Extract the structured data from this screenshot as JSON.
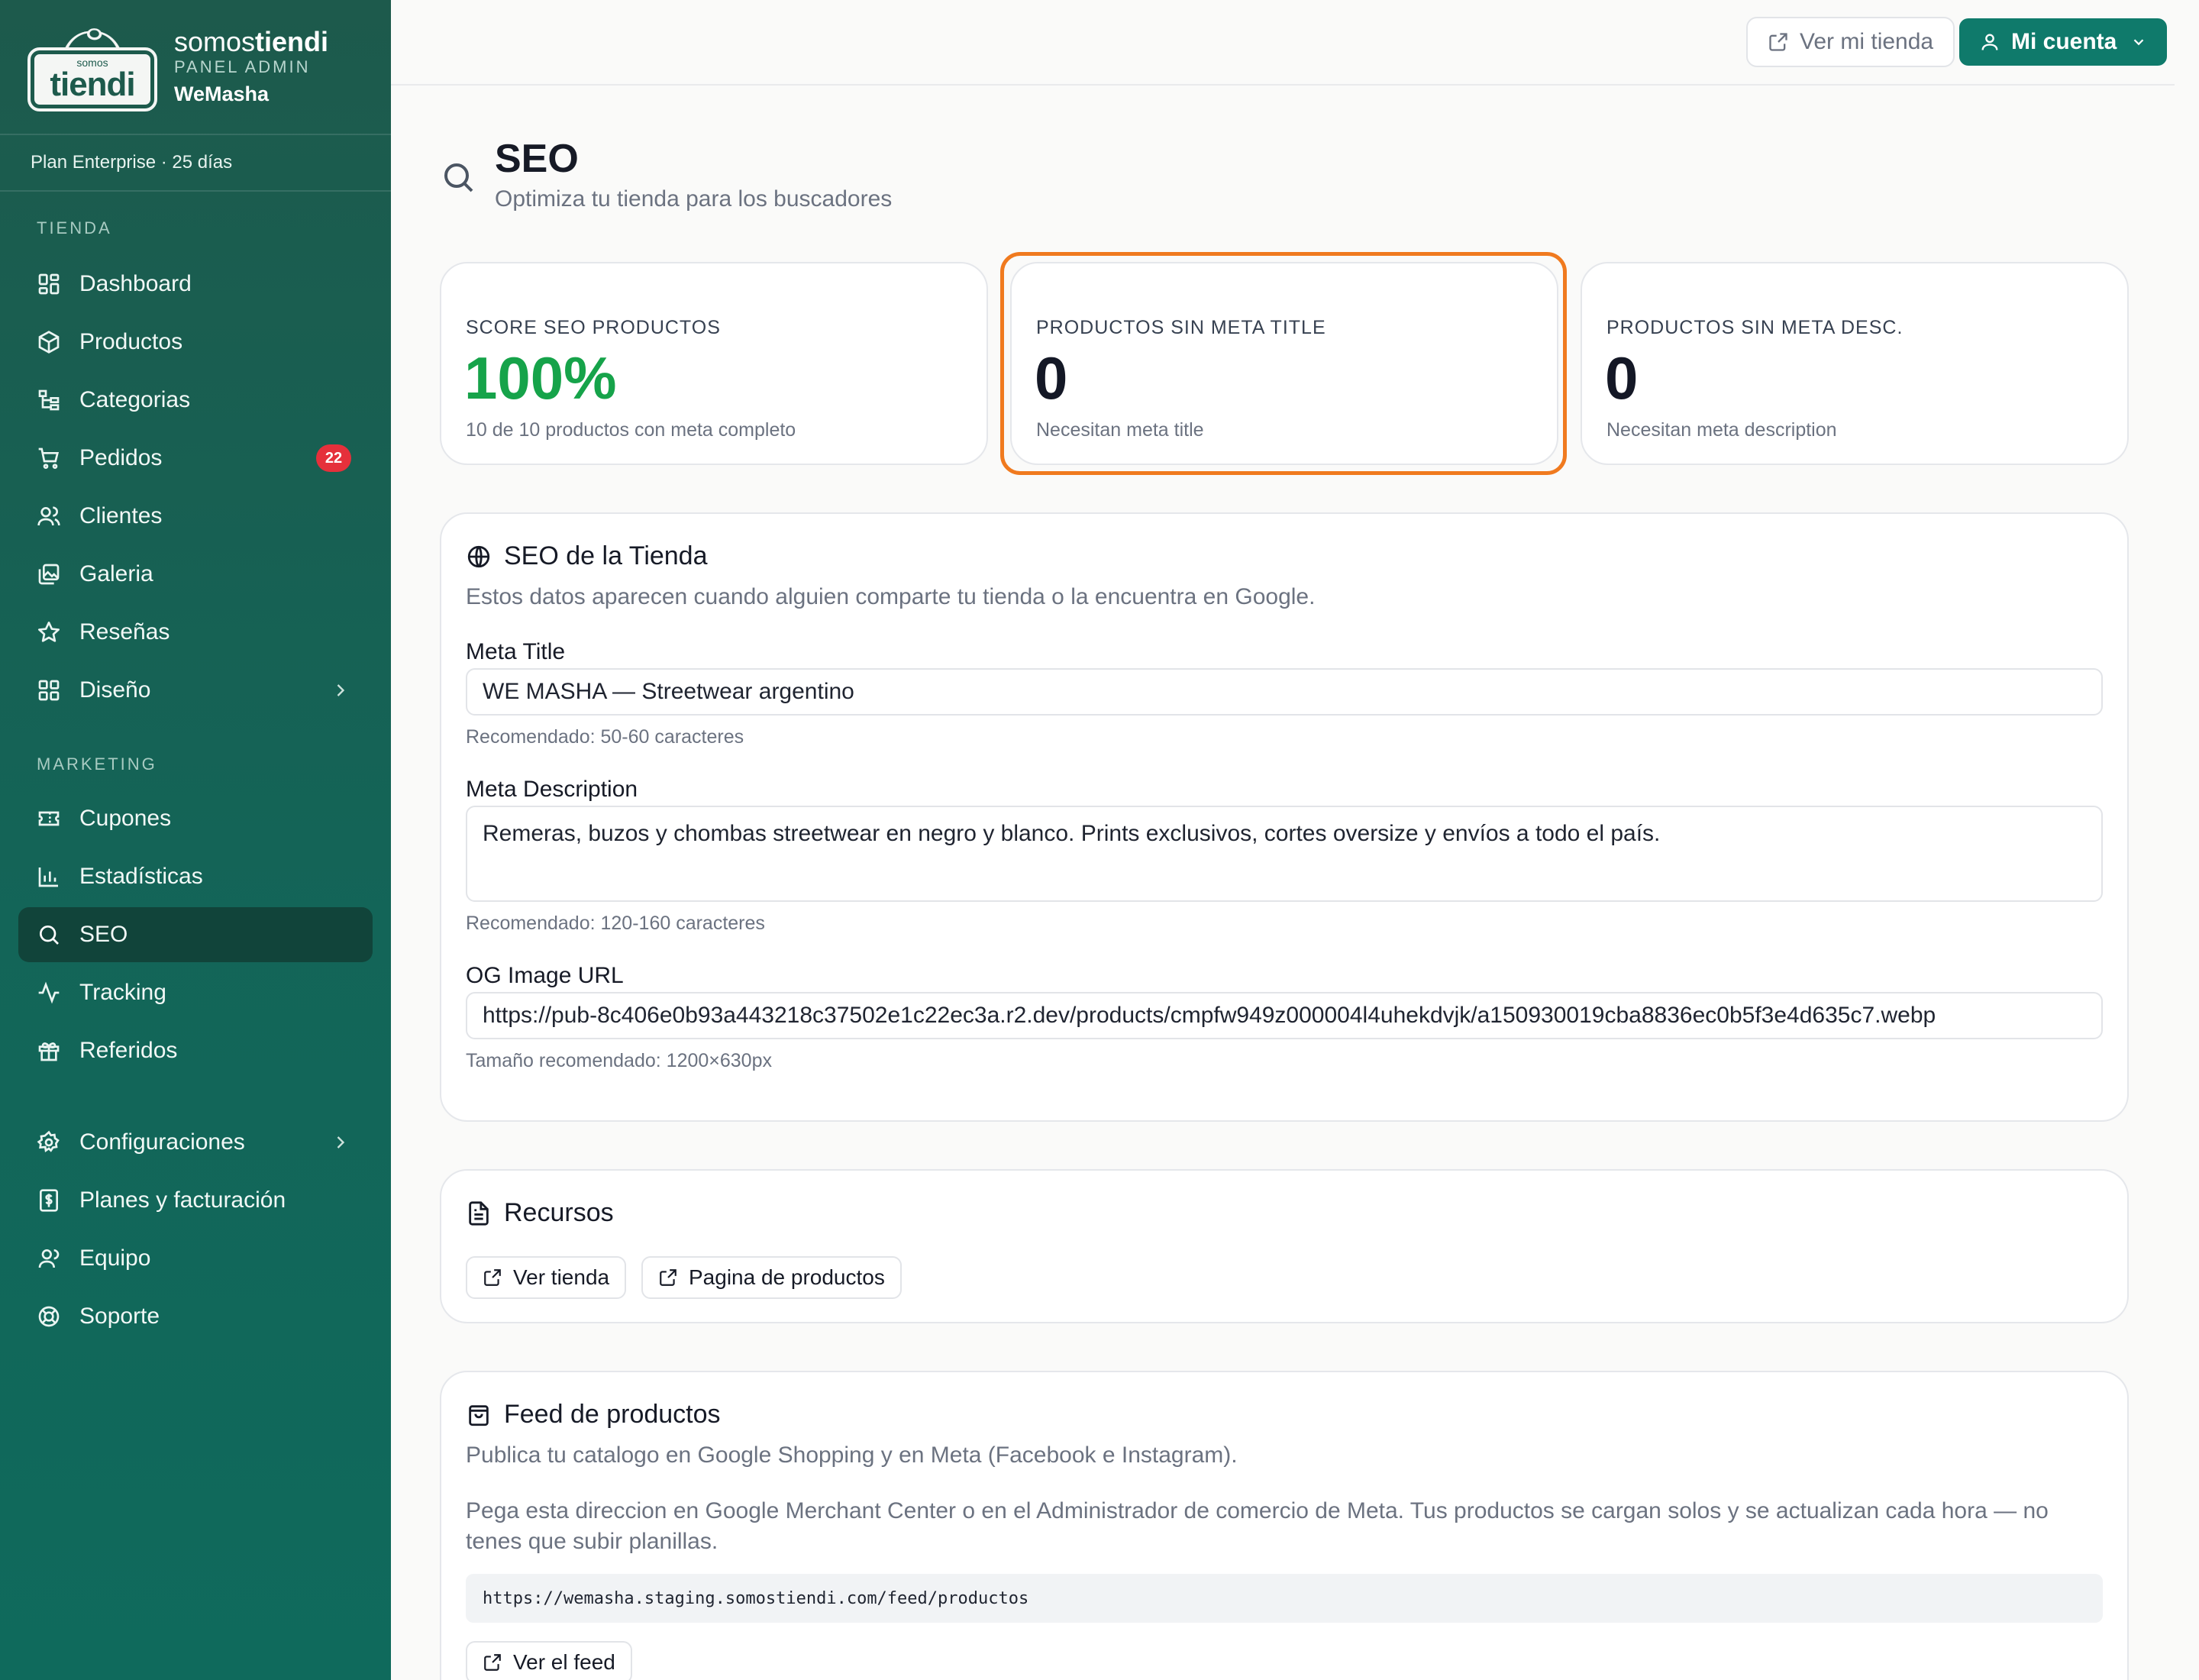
{
  "brand": {
    "name_light": "somos",
    "name_bold": "tiendi",
    "panel": "PANEL ADMIN",
    "store": "WeMasha",
    "logo_small": "somos",
    "logo_big": "tiendi"
  },
  "plan": "Plan Enterprise · 25 días",
  "sidebar": {
    "section_tienda": "TIENDA",
    "section_marketing": "MARKETING",
    "items": [
      {
        "label": "Dashboard",
        "icon": "grid-icon"
      },
      {
        "label": "Productos",
        "icon": "box-icon"
      },
      {
        "label": "Categorias",
        "icon": "tree-icon"
      },
      {
        "label": "Pedidos",
        "icon": "cart-icon",
        "badge": "22"
      },
      {
        "label": "Clientes",
        "icon": "users-icon"
      },
      {
        "label": "Galeria",
        "icon": "images-icon"
      },
      {
        "label": "Reseñas",
        "icon": "star-icon"
      },
      {
        "label": "Diseño",
        "icon": "layout-icon"
      },
      {
        "label": "Cupones",
        "icon": "ticket-icon"
      },
      {
        "label": "Estadísticas",
        "icon": "bar-chart-icon"
      },
      {
        "label": "SEO",
        "icon": "search-icon",
        "active": true
      },
      {
        "label": "Tracking",
        "icon": "activity-icon"
      },
      {
        "label": "Referidos",
        "icon": "gift-icon"
      },
      {
        "label": "Configuraciones",
        "icon": "gear-icon"
      },
      {
        "label": "Planes y facturación",
        "icon": "receipt-icon"
      },
      {
        "label": "Equipo",
        "icon": "team-icon"
      },
      {
        "label": "Soporte",
        "icon": "lifebuoy-icon"
      }
    ]
  },
  "topbar": {
    "view_store": "Ver mi tienda",
    "account": "Mi cuenta"
  },
  "page": {
    "title": "SEO",
    "subtitle": "Optimiza tu tienda para los buscadores"
  },
  "stats": [
    {
      "label": "SCORE SEO PRODUCTOS",
      "value": "100%",
      "note": "10 de 10 productos con meta completo"
    },
    {
      "label": "PRODUCTOS SIN META TITLE",
      "value": "0",
      "note": "Necesitan meta title"
    },
    {
      "label": "PRODUCTOS SIN META DESC.",
      "value": "0",
      "note": "Necesitan meta description"
    }
  ],
  "store_seo": {
    "title": "SEO de la Tienda",
    "description": "Estos datos aparecen cuando alguien comparte tu tienda o la encuentra en Google.",
    "meta_title_label": "Meta Title",
    "meta_title_value": "WE MASHA — Streetwear argentino",
    "meta_title_hint": "Recomendado: 50-60 caracteres",
    "meta_desc_label": "Meta Description",
    "meta_desc_value": "Remeras, buzos y chombas streetwear en negro y blanco. Prints exclusivos, cortes oversize y envíos a todo el país.",
    "meta_desc_hint": "Recomendado: 120-160 caracteres",
    "og_label": "OG Image URL",
    "og_value": "https://pub-8c406e0b93a443218c37502e1c22ec3a.r2.dev/products/cmpfw949z000004l4uhekdvjk/a150930019cba8836ec0b5f3e4d635c7.webp",
    "og_hint": "Tamaño recomendado: 1200×630px"
  },
  "resources": {
    "title": "Recursos",
    "btn_store": "Ver tienda",
    "btn_products": "Pagina de productos"
  },
  "feed": {
    "title": "Feed de productos",
    "description": "Publica tu catalogo en Google Shopping y en Meta (Facebook e Instagram).",
    "paragraph": "Pega esta direccion en Google Merchant Center o en el Administrador de comercio de Meta. Tus productos se cargan solos y se actualizan cada hora — no tenes que subir planillas.",
    "url": "https://wemasha.staging.somostiendi.com/feed/productos",
    "btn_feed": "Ver el feed"
  },
  "colors": {
    "sidebar": "#1d5a4c",
    "primary": "#0f7a6b",
    "highlight": "#f07a1f",
    "success": "#16a34a",
    "badge": "#e5303b"
  }
}
